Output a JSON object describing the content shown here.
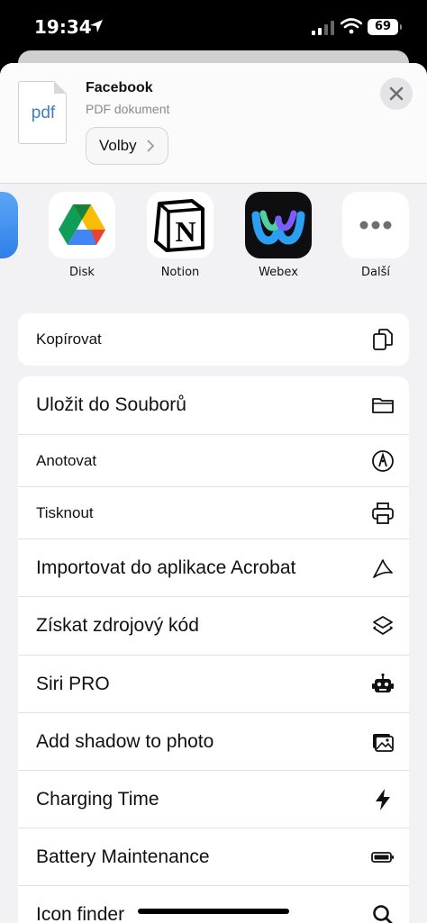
{
  "status": {
    "time": "19:34",
    "battery": "69"
  },
  "header": {
    "thumb_text": "pdf",
    "title": "Facebook",
    "subtitle": "PDF dokument",
    "options_label": "Volby"
  },
  "apps": [
    {
      "label": "Disk",
      "icon": "google-drive-icon"
    },
    {
      "label": "Notion",
      "icon": "notion-icon"
    },
    {
      "label": "Webex",
      "icon": "webex-icon"
    },
    {
      "label": "Další",
      "icon": "more-icon"
    }
  ],
  "copy": {
    "label": "Kopírovat",
    "icon": "copy-icon"
  },
  "actions": [
    {
      "label": "Uložit do Souborů",
      "icon": "folder-icon"
    },
    {
      "label": "Anotovat",
      "icon": "markup-pen-icon"
    },
    {
      "label": "Tisknout",
      "icon": "printer-icon"
    },
    {
      "label": "Importovat do aplikace Acrobat",
      "icon": "acrobat-icon"
    },
    {
      "label": "Získat zdrojový kód",
      "icon": "layers-icon"
    },
    {
      "label": "Siri PRO",
      "icon": "robot-icon"
    },
    {
      "label": "Add shadow to photo",
      "icon": "photos-icon"
    },
    {
      "label": "Charging Time",
      "icon": "bolt-icon"
    },
    {
      "label": "Battery Maintenance",
      "icon": "battery-icon"
    },
    {
      "label": "Icon finder",
      "icon": "search-icon"
    }
  ]
}
